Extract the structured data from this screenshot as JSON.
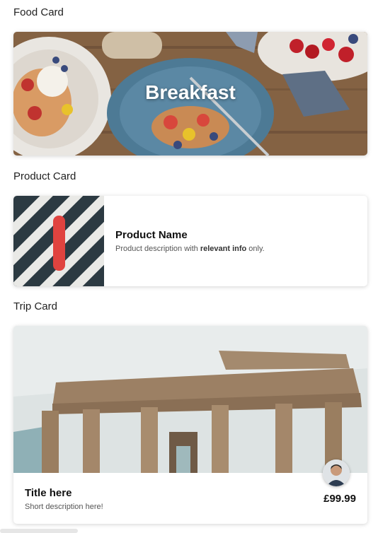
{
  "sections": {
    "food_title": "Food Card",
    "product_title": "Product Card",
    "trip_title": "Trip Card"
  },
  "food_card": {
    "title": "Breakfast"
  },
  "product_card": {
    "name": "Product Name",
    "description_prefix": "Product description with ",
    "description_bold": "relevant info",
    "description_suffix": " only."
  },
  "trip_card": {
    "title": "Title here",
    "description": "Short description here!",
    "price": "£99.99"
  },
  "colors": {
    "table_wood": "#8a6a4b",
    "plate_blue": "#5b88a4",
    "stripe_dark": "#2c3a42",
    "skateboard_red": "#e0433f",
    "sky": "#dde3e3",
    "stone": "#a48a6e"
  }
}
